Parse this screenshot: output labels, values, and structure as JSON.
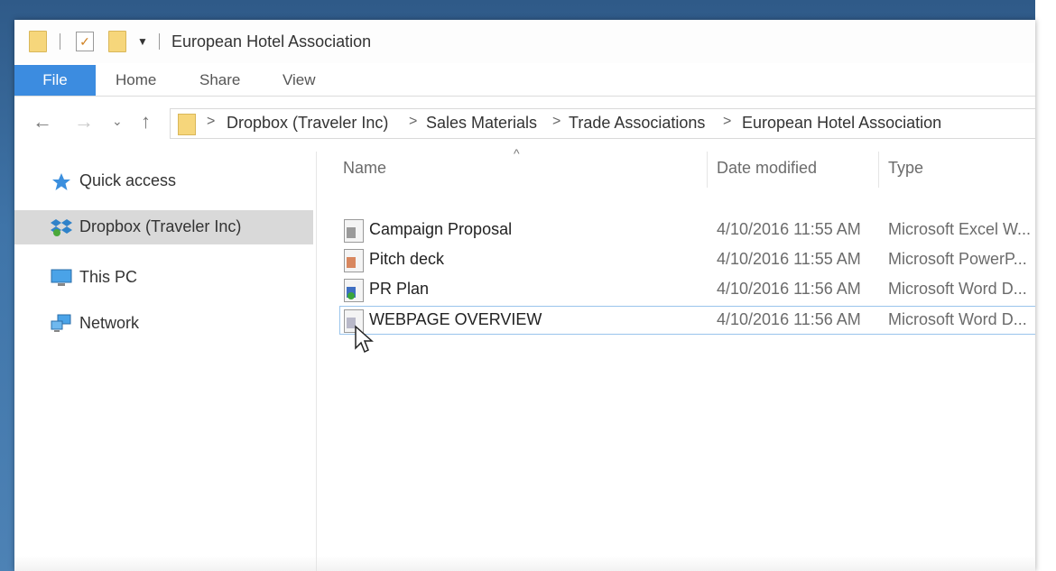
{
  "window": {
    "title": "European Hotel Association"
  },
  "ribbon": {
    "tabs": [
      {
        "label": "File",
        "active": true
      },
      {
        "label": "Home"
      },
      {
        "label": "Share"
      },
      {
        "label": "View"
      }
    ]
  },
  "address": {
    "crumbs": [
      "Dropbox (Traveler Inc)",
      "Sales Materials",
      "Trade Associations",
      "European Hotel Association"
    ],
    "separator": ">"
  },
  "navpane": {
    "items": [
      {
        "label": "Quick access",
        "icon": "star-icon"
      },
      {
        "label": "Dropbox (Traveler Inc)",
        "icon": "dropbox-icon",
        "selected": true
      },
      {
        "label": "This PC",
        "icon": "computer-icon"
      },
      {
        "label": "Network",
        "icon": "network-icon"
      }
    ]
  },
  "columns": {
    "name": "Name",
    "date": "Date modified",
    "type": "Type"
  },
  "files": [
    {
      "name": "Campaign Proposal",
      "date": "4/10/2016 11:55 AM",
      "type": "Microsoft Excel W...",
      "icon": "excel-file-icon"
    },
    {
      "name": "Pitch deck",
      "date": "4/10/2016 11:55 AM",
      "type": "Microsoft PowerP...",
      "icon": "powerpoint-file-icon"
    },
    {
      "name": "PR Plan",
      "date": "4/10/2016 11:56 AM",
      "type": "Microsoft Word D...",
      "icon": "word-file-synced-icon"
    },
    {
      "name": "WEBPAGE OVERVIEW",
      "date": "4/10/2016 11:56 AM",
      "type": "Microsoft Word D...",
      "icon": "word-file-icon",
      "selected": true
    }
  ],
  "colors": {
    "file_tab": "#3c8ce0",
    "selected_row_border": "#99c4ec",
    "nav_selected": "#d9d9d9",
    "folder": "#f6d67b"
  }
}
